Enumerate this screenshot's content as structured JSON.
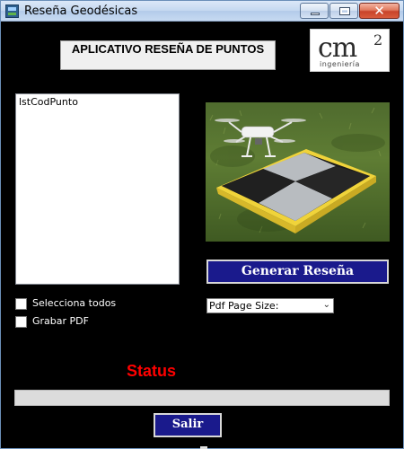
{
  "window": {
    "title": "Reseña Geodésicas",
    "close_glyph": "✕"
  },
  "header": {
    "title": "APLICATIVO RESEÑA DE PUNTOS"
  },
  "logo": {
    "main": "cm",
    "sup": "2",
    "sub": "ingeniería"
  },
  "list": {
    "items": [
      "lstCodPunto"
    ]
  },
  "buttons": {
    "generar": "Generar Reseña",
    "salir": "Salir"
  },
  "checkboxes": [
    {
      "label": "Selecciona todos",
      "checked": false
    },
    {
      "label": "Grabar PDF",
      "checked": false
    }
  ],
  "combo": {
    "value": "Pdf Page Size:"
  },
  "status": {
    "label": "Status",
    "text": ""
  },
  "icons": {
    "window_icon": "app-icon",
    "combo_arrow": "chevron-down-icon"
  },
  "colors": {
    "background": "#000000",
    "button_blue": "#1a1a8c",
    "status_red": "#ff0000"
  }
}
